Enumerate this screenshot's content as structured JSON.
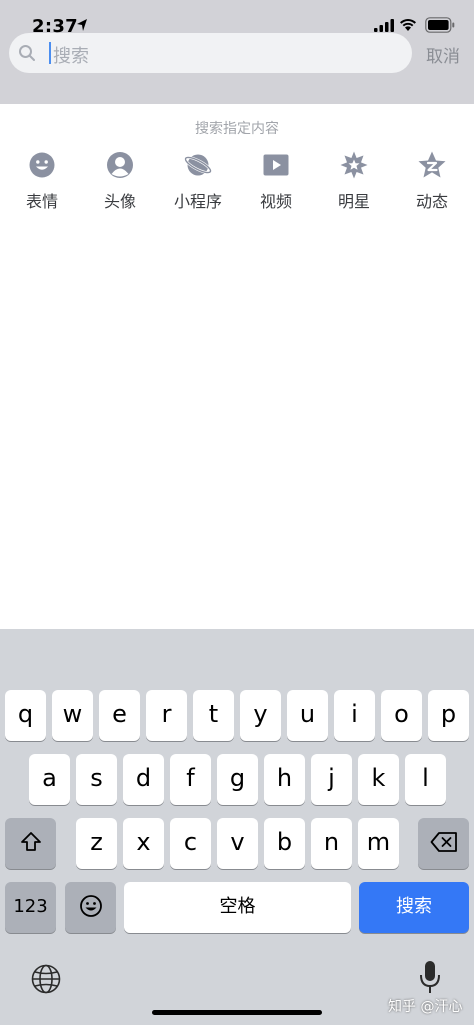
{
  "status_bar": {
    "time": "2:37"
  },
  "search": {
    "placeholder": "搜索",
    "cancel_label": "取消"
  },
  "content": {
    "hint": "搜索指定内容",
    "categories": [
      {
        "label": "表情",
        "icon": "smiley-icon"
      },
      {
        "label": "头像",
        "icon": "avatar-icon"
      },
      {
        "label": "小程序",
        "icon": "planet-icon"
      },
      {
        "label": "视频",
        "icon": "play-icon"
      },
      {
        "label": "明星",
        "icon": "star-badge-icon"
      },
      {
        "label": "动态",
        "icon": "star-z-icon"
      }
    ]
  },
  "keyboard": {
    "row1": [
      "q",
      "w",
      "e",
      "r",
      "t",
      "y",
      "u",
      "i",
      "o",
      "p"
    ],
    "row2": [
      "a",
      "s",
      "d",
      "f",
      "g",
      "h",
      "j",
      "k",
      "l"
    ],
    "row3": [
      "z",
      "x",
      "c",
      "v",
      "b",
      "n",
      "m"
    ],
    "numbers_label": "123",
    "space_label": "空格",
    "return_label": "搜索",
    "accent_color": "#3478f6"
  },
  "watermark": "知乎 @汗心"
}
